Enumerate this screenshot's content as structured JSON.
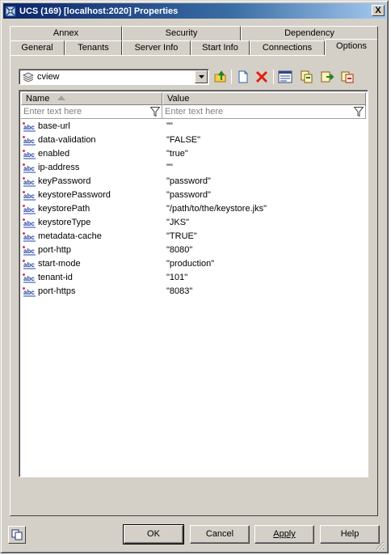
{
  "window": {
    "title": "UCS (169) [localhost:2020] Properties",
    "close_label": "X"
  },
  "tabs_top": [
    {
      "label": "Annex"
    },
    {
      "label": "Security"
    },
    {
      "label": "Dependency"
    }
  ],
  "tabs_bottom": [
    {
      "label": "General"
    },
    {
      "label": "Tenants"
    },
    {
      "label": "Server Info"
    },
    {
      "label": "Start Info"
    },
    {
      "label": "Connections"
    },
    {
      "label": "Options"
    }
  ],
  "active_tab": "Options",
  "view_selector": {
    "value": "cview"
  },
  "grid": {
    "columns": [
      {
        "label": "Name"
      },
      {
        "label": "Value"
      }
    ],
    "filter_placeholder": "Enter text here",
    "rows": [
      {
        "name": "base-url",
        "value": "\"\""
      },
      {
        "name": "data-validation",
        "value": "\"FALSE\""
      },
      {
        "name": "enabled",
        "value": "\"true\""
      },
      {
        "name": "ip-address",
        "value": "\"\""
      },
      {
        "name": "keyPassword",
        "value": "\"password\""
      },
      {
        "name": "keystorePassword",
        "value": "\"password\""
      },
      {
        "name": "keystorePath",
        "value": "\"/path/to/the/keystore.jks\""
      },
      {
        "name": "keystoreType",
        "value": "\"JKS\""
      },
      {
        "name": "metadata-cache",
        "value": "\"TRUE\""
      },
      {
        "name": "port-http",
        "value": "\"8080\""
      },
      {
        "name": "start-mode",
        "value": "\"production\""
      },
      {
        "name": "tenant-id",
        "value": "\"101\""
      },
      {
        "name": "port-https",
        "value": "\"8083\""
      }
    ]
  },
  "buttons": {
    "ok": "OK",
    "cancel": "Cancel",
    "apply": "Apply",
    "help": "Help"
  },
  "icons": {
    "window": "app-icon",
    "view": "layers-icon",
    "row": "abc-string-icon"
  },
  "colors": {
    "titlebar_start": "#0a246a",
    "titlebar_end": "#a6caf0",
    "dialog_bg": "#d4d0c8",
    "delete_red": "#e02010"
  }
}
